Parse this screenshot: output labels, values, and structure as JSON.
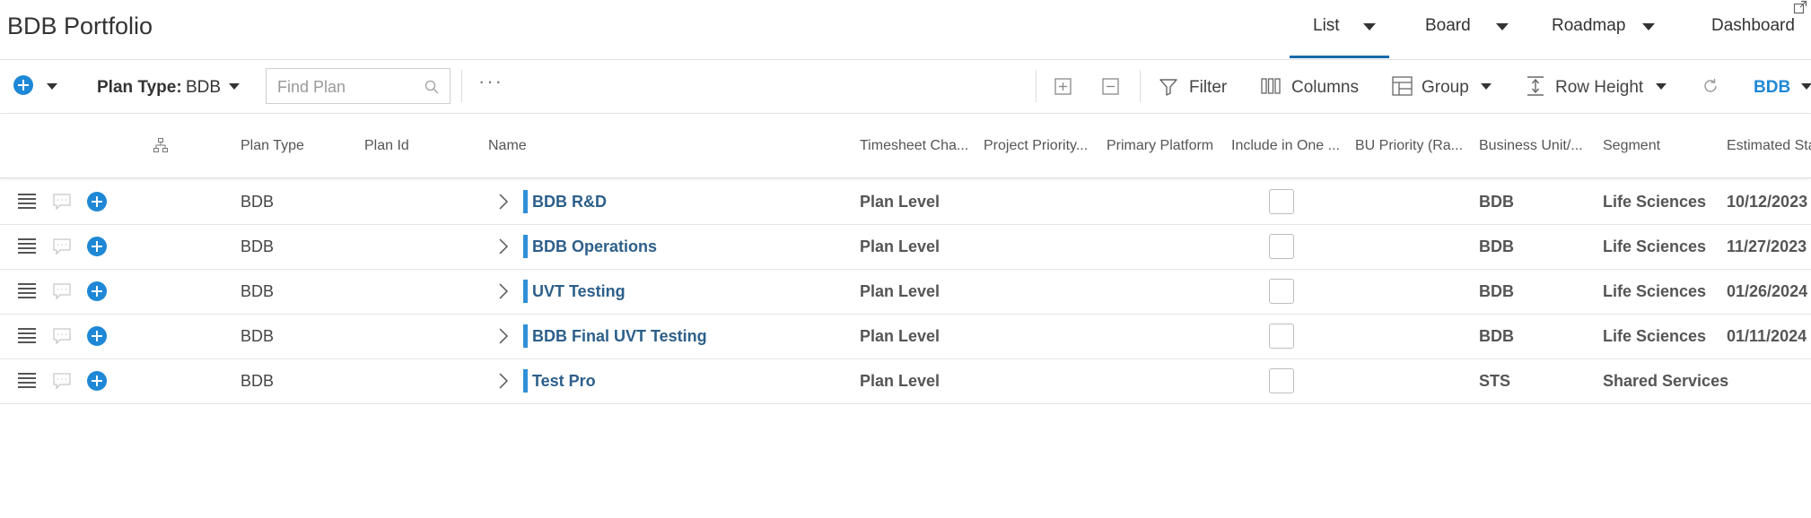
{
  "header": {
    "title": "BDB Portfolio",
    "views": [
      {
        "label": "List"
      },
      {
        "label": "Board"
      },
      {
        "label": "Roadmap"
      },
      {
        "label": "Dashboard"
      }
    ]
  },
  "toolbar": {
    "plan_type_label": "Plan Type:",
    "plan_type_value": "BDB",
    "search_placeholder": "Find Plan",
    "more": "···",
    "filter_label": "Filter",
    "columns_label": "Columns",
    "group_label": "Group",
    "row_height_label": "Row Height",
    "bdb_label": "BDB"
  },
  "columns": [
    "Plan Type",
    "Plan Id",
    "Name",
    "Timesheet Cha...",
    "Project Priority...",
    "Primary Platform",
    "Include in One ...",
    "BU Priority (Ra...",
    "Business Unit/...",
    "Segment",
    "Estimated Sta"
  ],
  "rows": [
    {
      "plan_type": "BDB",
      "name": "BDB R&D",
      "timesheet": "Plan Level",
      "include": false,
      "business_unit": "BDB",
      "segment": "Life Sciences",
      "estimated_start": "10/12/2023"
    },
    {
      "plan_type": "BDB",
      "name": "BDB Operations",
      "timesheet": "Plan Level",
      "include": false,
      "business_unit": "BDB",
      "segment": "Life Sciences",
      "estimated_start": "11/27/2023"
    },
    {
      "plan_type": "BDB",
      "name": "UVT Testing",
      "timesheet": "Plan Level",
      "include": false,
      "business_unit": "BDB",
      "segment": "Life Sciences",
      "estimated_start": "01/26/2024"
    },
    {
      "plan_type": "BDB",
      "name": "BDB Final UVT Testing",
      "timesheet": "Plan Level",
      "include": false,
      "business_unit": "BDB",
      "segment": "Life Sciences",
      "estimated_start": "01/11/2024"
    },
    {
      "plan_type": "BDB",
      "name": "Test Pro",
      "timesheet": "Plan Level",
      "include": false,
      "business_unit": "STS",
      "segment": "Shared Services",
      "estimated_start": ""
    }
  ],
  "colors": {
    "accent": "#1e88d6",
    "name_text": "#2c5f8a",
    "active_tab_underline": "#1769aa"
  },
  "active_view": "List"
}
